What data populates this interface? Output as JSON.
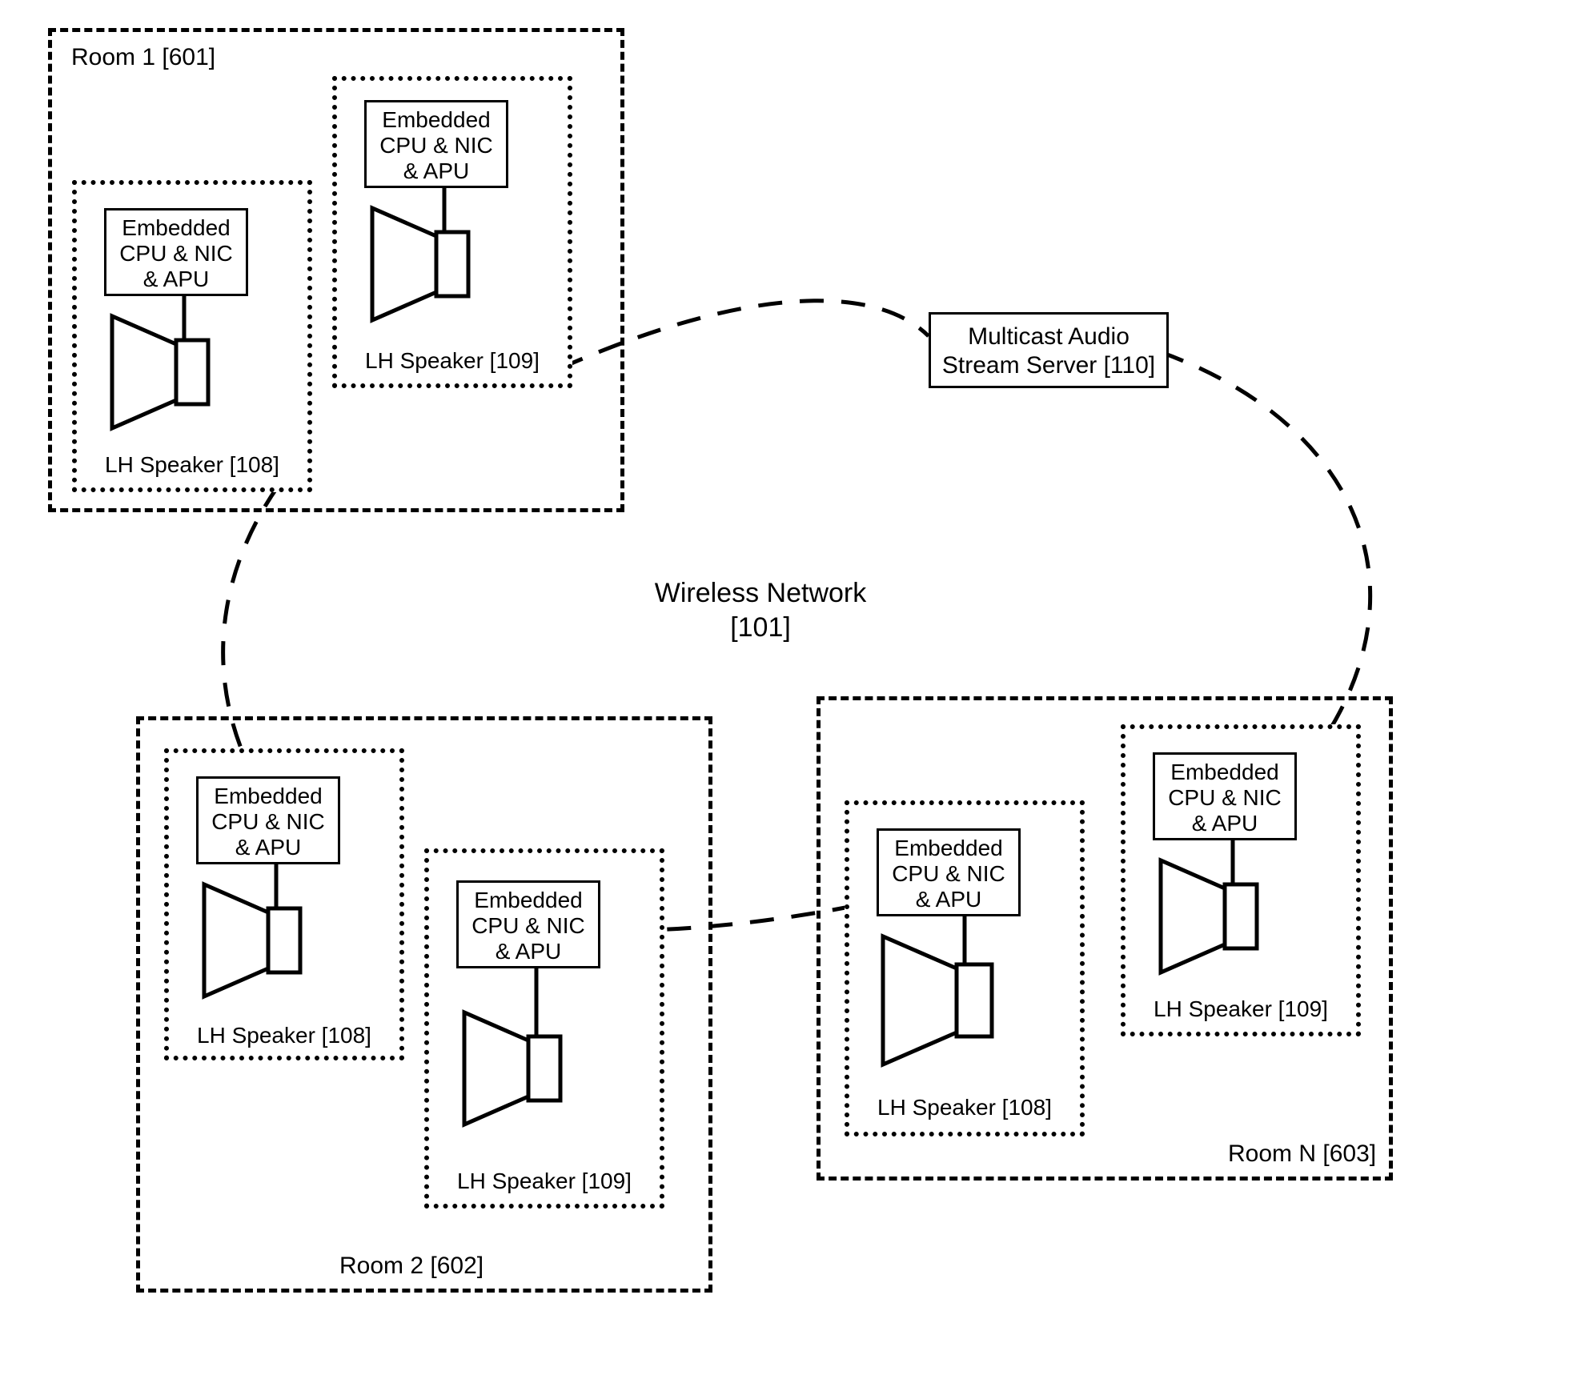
{
  "network": {
    "label_line1": "Wireless Network",
    "label_line2": "[101]"
  },
  "server": {
    "line1": "Multicast Audio",
    "line2": "Stream Server [110]"
  },
  "cpu_box": {
    "line1": "Embedded",
    "line2": "CPU & NIC",
    "line3": "& APU"
  },
  "rooms": [
    {
      "id": "601",
      "label": "Room 1 [601]"
    },
    {
      "id": "602",
      "label": "Room 2 [602]"
    },
    {
      "id": "603",
      "label": "Room N [603]"
    }
  ],
  "speakers": {
    "lh108": "LH Speaker [108]",
    "lh109": "LH Speaker [109]"
  }
}
